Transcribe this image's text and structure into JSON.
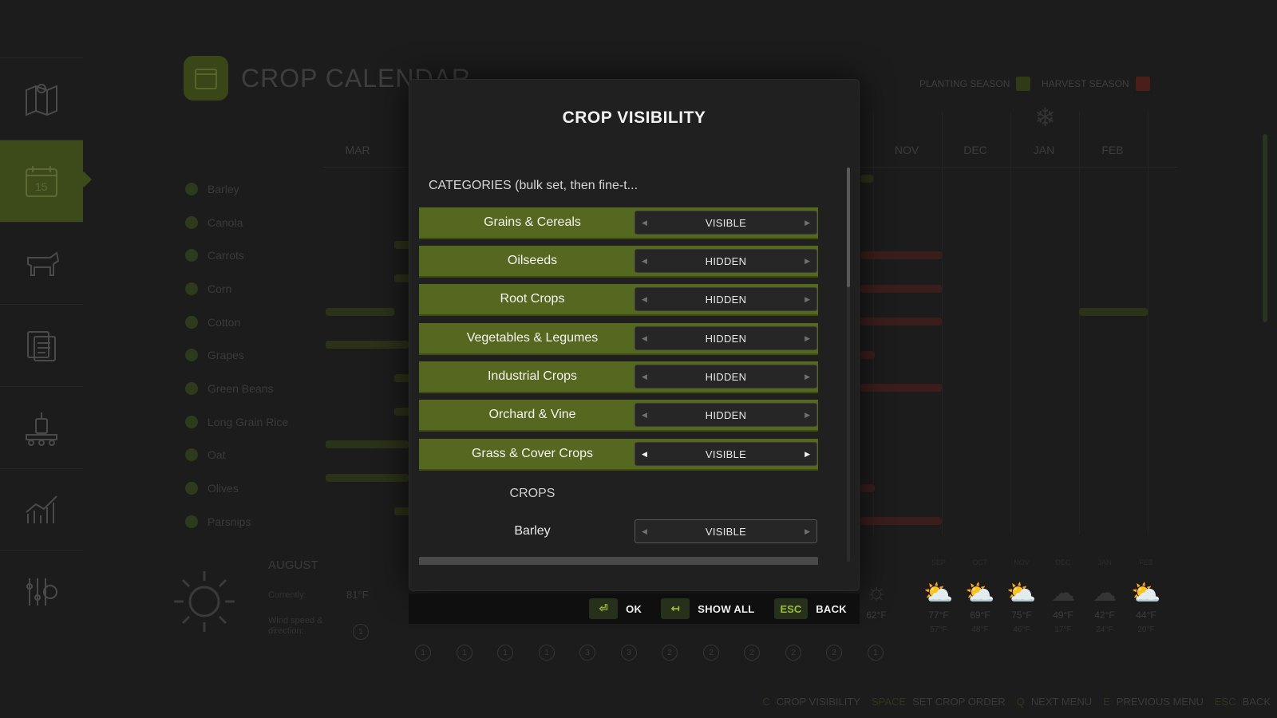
{
  "app": {
    "title": "CROP CALENDAR"
  },
  "sidebar": {
    "items": [
      {
        "icon": "map-icon"
      },
      {
        "icon": "calendar-icon",
        "active": true
      },
      {
        "icon": "cow-icon"
      },
      {
        "icon": "contracts-icon"
      },
      {
        "icon": "production-icon"
      },
      {
        "icon": "statistics-icon"
      },
      {
        "icon": "settings-icon"
      }
    ]
  },
  "legend": {
    "planting_label": "PLANTING SEASON",
    "planting_color": "#4a5a20",
    "harvest_label": "HARVEST SEASON",
    "harvest_color": "#6a2a24"
  },
  "calendar": {
    "months": [
      "MAR",
      "NOV",
      "DEC",
      "JAN",
      "FEB"
    ],
    "crops": [
      "Barley",
      "Canola",
      "Carrots",
      "Corn",
      "Cotton",
      "Grapes",
      "Green Beans",
      "Long Grain Rice",
      "Oat",
      "Olives",
      "Parsnips"
    ]
  },
  "weather": {
    "month": "AUGUST",
    "currently_label": "Currently:",
    "currently_value": "81°F",
    "wind_label": "Wind speed & direction:",
    "wind_value": "1",
    "forecast_temp_extra": "62°F",
    "forecast": [
      {
        "hi": "77°F",
        "lo": "57°F",
        "icon": "partly-cloudy-icon"
      },
      {
        "hi": "69°F",
        "lo": "48°F",
        "icon": "partly-cloudy-icon"
      },
      {
        "hi": "75°F",
        "lo": "46°F",
        "icon": "partly-cloudy-icon"
      },
      {
        "hi": "49°F",
        "lo": "17°F",
        "icon": "rain-cloud-icon"
      },
      {
        "hi": "42°F",
        "lo": "24°F",
        "icon": "rain-cloud-icon"
      },
      {
        "hi": "44°F",
        "lo": "20°F",
        "icon": "partly-cloudy-icon"
      }
    ],
    "forecast_months": [
      "SEP",
      "OCT",
      "NOV",
      "DEC",
      "JAN",
      "FEB"
    ],
    "wind_values": [
      "1",
      "1",
      "1",
      "1",
      "3",
      "3",
      "2",
      "2",
      "2",
      "2",
      "2",
      "1"
    ]
  },
  "bottom_bar": [
    {
      "key": "C",
      "label": "CROP VISIBILITY"
    },
    {
      "key": "SPACE",
      "label": "SET CROP ORDER"
    },
    {
      "key": "Q",
      "label": "NEXT MENU"
    },
    {
      "key": "E",
      "label": "PREVIOUS MENU"
    },
    {
      "key": "ESC",
      "label": "BACK"
    }
  ],
  "modal": {
    "title": "CROP VISIBILITY",
    "categories_heading": "CATEGORIES  (bulk set, then fine-t...",
    "categories": [
      {
        "label": "Grains & Cereals",
        "value": "VISIBLE"
      },
      {
        "label": "Oilseeds",
        "value": "HIDDEN"
      },
      {
        "label": "Root Crops",
        "value": "HIDDEN"
      },
      {
        "label": "Vegetables & Legumes",
        "value": "HIDDEN"
      },
      {
        "label": "Industrial Crops",
        "value": "HIDDEN"
      },
      {
        "label": "Orchard & Vine",
        "value": "HIDDEN"
      },
      {
        "label": "Grass & Cover Crops",
        "value": "VISIBLE"
      }
    ],
    "crops_heading": "CROPS",
    "crops": [
      {
        "label": "Barley",
        "value": "VISIBLE"
      }
    ],
    "footer": {
      "ok_key": "⏎",
      "ok_label": "OK",
      "showall_key": "↤",
      "showall_label": "SHOW ALL",
      "back_key": "ESC",
      "back_label": "BACK"
    }
  }
}
